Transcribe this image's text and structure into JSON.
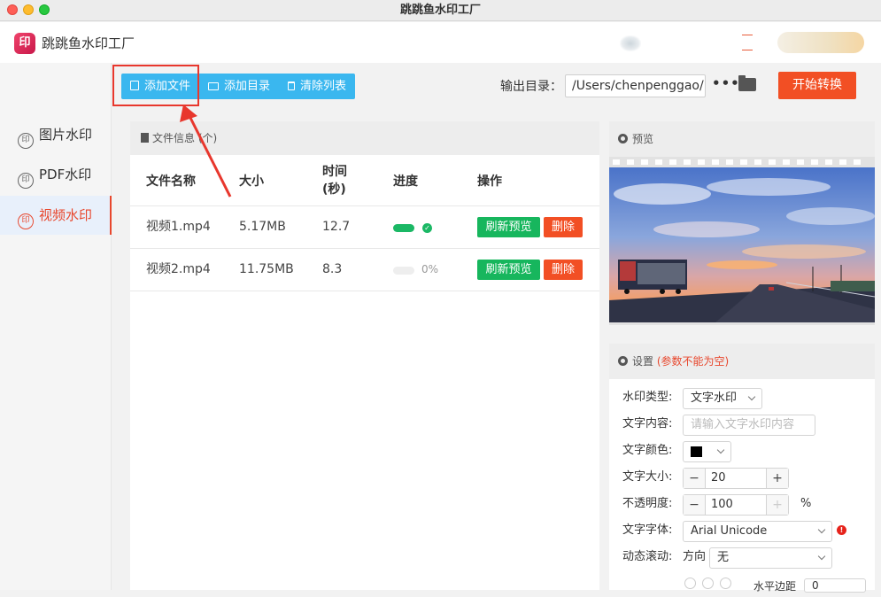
{
  "window": {
    "title": "跳跳鱼水印工厂"
  },
  "header": {
    "app_name": "跳跳鱼水印工厂",
    "logo_glyph": "印"
  },
  "sidebar": {
    "items": [
      {
        "label": "图片水印",
        "icon": "印",
        "active": false
      },
      {
        "label": "PDF水印",
        "icon": "印",
        "active": false
      },
      {
        "label": "视频水印",
        "icon": "印",
        "active": true
      }
    ]
  },
  "toolbar": {
    "add_file": "添加文件",
    "add_dir": "添加目录",
    "clear_list": "清除列表",
    "output_label": "输出目录：",
    "output_path": "/Users/chenpenggao/D",
    "more": "•••",
    "start": "开始转换"
  },
  "file_panel": {
    "title": "文件信息 (个)",
    "columns": {
      "name": "文件名称",
      "size": "大小",
      "time_line1": "时间",
      "time_line2": "(秒)",
      "progress": "进度",
      "actions": "操作"
    },
    "rows": [
      {
        "name": "视频1.mp4",
        "size": "5.17MB",
        "time": "12.7",
        "progress": 1.0,
        "progress_text": "",
        "done": true,
        "refresh": "刷新预览",
        "delete": "删除"
      },
      {
        "name": "视频2.mp4",
        "size": "11.75MB",
        "time": "8.3",
        "progress": 0.0,
        "progress_text": "0%",
        "done": false,
        "refresh": "刷新预览",
        "delete": "删除"
      }
    ]
  },
  "preview": {
    "title": "预览"
  },
  "settings": {
    "title": "设置",
    "title_note": "(参数不能为空)",
    "watermark_type_label": "水印类型:",
    "watermark_type_value": "文字水印",
    "text_content_label": "文字内容:",
    "text_content_placeholder": "请输入文字水印内容",
    "text_color_label": "文字颜色:",
    "text_color_value": "#000000",
    "text_size_label": "文字大小:",
    "text_size_value": "20",
    "opacity_label": "不透明度:",
    "opacity_value": "100",
    "opacity_unit": "%",
    "font_label": "文字字体:",
    "font_value": "Arial Unicode",
    "scroll_label": "动态滚动:",
    "direction_label": "方向",
    "direction_value": "无",
    "h_margin_label": "水平边距",
    "h_margin_value": "0",
    "minus": "−",
    "plus": "+"
  },
  "colors": {
    "accent_blue": "#3ab7ef",
    "accent_red": "#f24f24",
    "accent_green": "#17b65d"
  }
}
